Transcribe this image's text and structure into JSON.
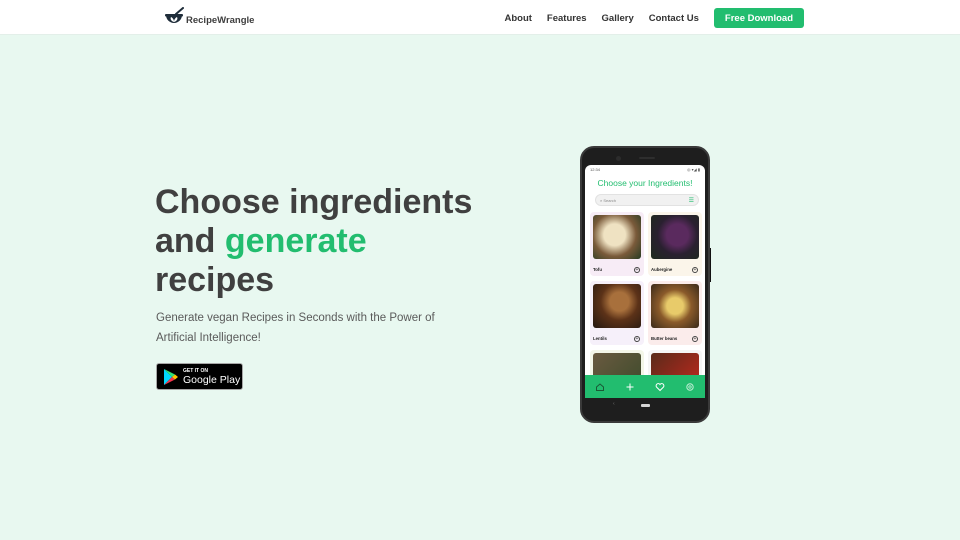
{
  "nav": {
    "brand": "RecipeWrangle",
    "links": [
      "About",
      "Features",
      "Gallery",
      "Contact Us"
    ],
    "cta": "Free Download"
  },
  "hero": {
    "title_part1": "Choose ingredients",
    "title_part2": "and ",
    "title_accent": "generate",
    "title_part3": "recipes",
    "subtitle": "Generate vegan Recipes in Seconds with the Power of Artificial Intelligence!",
    "store_small": "GET IT ON",
    "store_big": "Google Play"
  },
  "phone": {
    "time": "12:34",
    "status_icons": "◎ ▾◢ ▮",
    "app_title": "Choose your Ingredients!",
    "search_placeholder": "Search",
    "ingredients": [
      {
        "name": "Tofu",
        "bg": "#f7ecf6"
      },
      {
        "name": "Aubergine",
        "bg": "#fbf5ea"
      },
      {
        "name": "Lentils",
        "bg": "#f6f0fa"
      },
      {
        "name": "Butter beans",
        "bg": "#fbeceb"
      },
      {
        "name": "",
        "bg": "#f3f6e8"
      },
      {
        "name": "",
        "bg": "#f5f5f5"
      }
    ],
    "bottom_nav": [
      "home",
      "add",
      "favorites",
      "settings"
    ]
  },
  "colors": {
    "accent": "#22bd6f",
    "background": "#e8f8f0",
    "heading": "#404040"
  }
}
